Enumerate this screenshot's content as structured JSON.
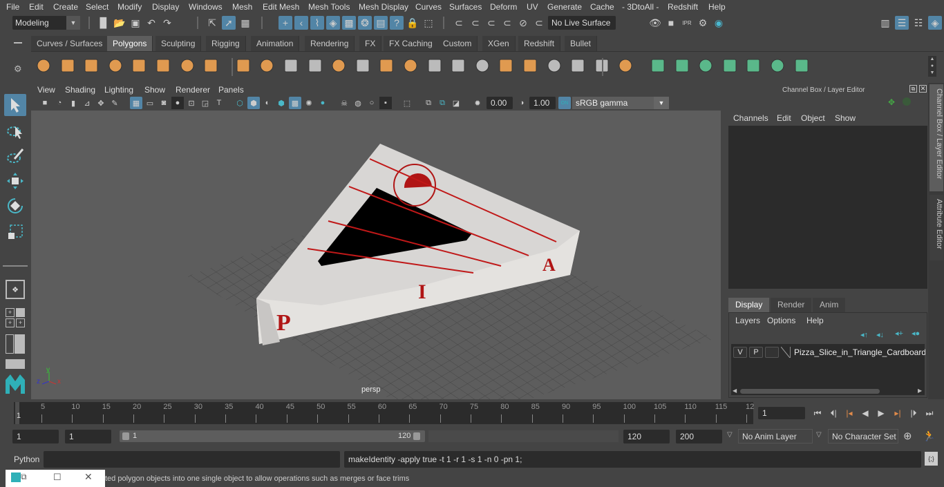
{
  "menubar": {
    "items": [
      "File",
      "Edit",
      "Create",
      "Select",
      "Modify",
      "Display",
      "Windows",
      "Mesh",
      "Edit Mesh",
      "Mesh Tools",
      "Mesh Display",
      "Curves",
      "Surfaces",
      "Deform",
      "UV",
      "Generate",
      "Cache",
      "- 3DtoAll -",
      "Redshift",
      "Help"
    ]
  },
  "statusline": {
    "workspace": "Modeling",
    "live_surface": "No Live Surface"
  },
  "shelf": {
    "tabs": [
      "Curves / Surfaces",
      "Polygons",
      "Sculpting",
      "Rigging",
      "Animation",
      "Rendering",
      "FX",
      "FX Caching",
      "Custom",
      "XGen",
      "Redshift",
      "Bullet"
    ],
    "active_tab": "Polygons",
    "icons": [
      "poly-sphere-icon",
      "poly-cube-icon",
      "poly-cylinder-icon",
      "poly-cone-icon",
      "poly-diamond-icon",
      "poly-torus-icon",
      "poly-pyramid-icon",
      "poly-pipe-icon",
      "combine-icon",
      "separate-icon",
      "mirror-icon",
      "smooth-icon",
      "extract-icon",
      "bevel-icon",
      "bridge-icon",
      "extrude-icon",
      "append-icon",
      "multi-cut-icon",
      "target-weld-icon",
      "bevel-cube-icon",
      "edge-loop-icon",
      "insert-loop-icon",
      "offset-loop-icon",
      "bridge-faces-icon",
      "quad-draw-icon",
      "uv-planar-icon",
      "uv-cylindrical-icon",
      "uv-spherical-icon",
      "uv-automatic-icon",
      "uv-unfold-icon",
      "uv-editor-icon",
      "uv-layout-icon"
    ]
  },
  "viewport": {
    "menu": [
      "View",
      "Shading",
      "Lighting",
      "Show",
      "Renderer",
      "Panels"
    ],
    "exposure": "0.00",
    "gamma": "1.00",
    "color_mgmt": "ON",
    "color_space": "sRGB gamma",
    "camera_label": "persp",
    "axis": {
      "x": "x",
      "y": "y",
      "z": "z"
    }
  },
  "rightpanel": {
    "title": "Channel Box / Layer Editor",
    "cb_menu": [
      "Channels",
      "Edit",
      "Object",
      "Show"
    ],
    "layer_tabs": [
      "Display",
      "Render",
      "Anim"
    ],
    "active_layer_tab": "Display",
    "layer_menu": [
      "Layers",
      "Options",
      "Help"
    ],
    "layer": {
      "v": "V",
      "p": "P",
      "name": "Pizza_Slice_in_Triangle_Cardboard_Bo"
    },
    "side_tabs": [
      "Channel Box / Layer Editor",
      "Attribute Editor"
    ]
  },
  "timeline": {
    "labels": [
      "5",
      "10",
      "15",
      "20",
      "25",
      "30",
      "35",
      "40",
      "45",
      "50",
      "55",
      "60",
      "65",
      "70",
      "75",
      "80",
      "85",
      "90",
      "95",
      "100",
      "105",
      "110",
      "115",
      "12"
    ],
    "current_frame_marker": "1",
    "current_frame": "1"
  },
  "range": {
    "start": "1",
    "playback_start": "1",
    "slider_start": "1",
    "slider_end": "120",
    "playback_end": "120",
    "end": "200",
    "anim_layer": "No Anim Layer",
    "character_set": "No Character Set"
  },
  "command": {
    "lang": "Python",
    "input": "",
    "output": "makeIdentity -apply true -t 1 -r 1 -s 1 -n 0 -pn 1;"
  },
  "helpline": {
    "text": "ted polygon objects into one single object to allow operations such as merges or face trims"
  }
}
